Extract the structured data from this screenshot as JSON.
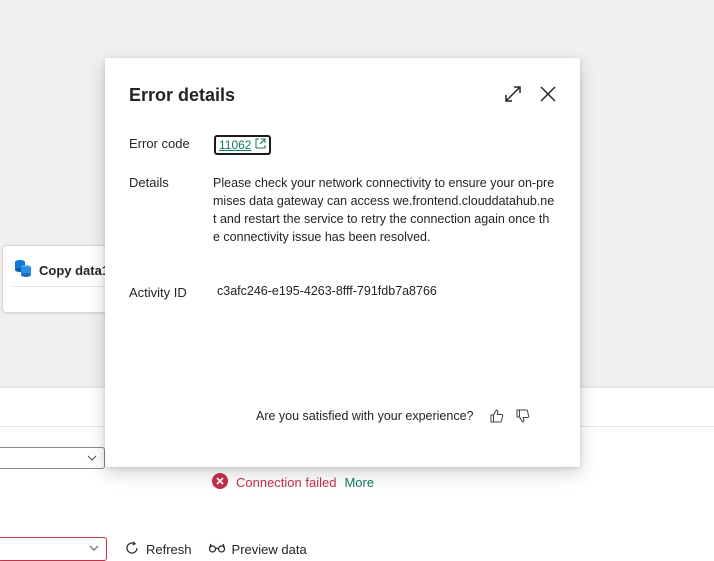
{
  "canvas": {
    "activity": {
      "label": "Copy data1",
      "icon": "database-copy-icon"
    }
  },
  "status": {
    "message": "Connection failed",
    "more_link": "More",
    "icon": "error-circle-icon",
    "color": "#c4314b"
  },
  "toolbar": {
    "refresh_label": "Refresh",
    "preview_label": "Preview data"
  },
  "dialog": {
    "title": "Error details",
    "error_code_label": "Error code",
    "error_code_value": "11062",
    "details_label": "Details",
    "details_text": " Please check your network connectivity to ensure your on-premises data gateway can access we.frontend.clouddatahub.net and restart the service to retry the connection again once the connectivity issue has been resolved.",
    "activity_id_label": "Activity ID",
    "activity_id_value": "c3afc246-e195-4263-8fff-791fdb7a8766",
    "feedback_question": "Are you satisfied with your experience?"
  },
  "colors": {
    "accent": "#117865",
    "error": "#c4314b",
    "canvas_bg": "#f0f0f0"
  }
}
